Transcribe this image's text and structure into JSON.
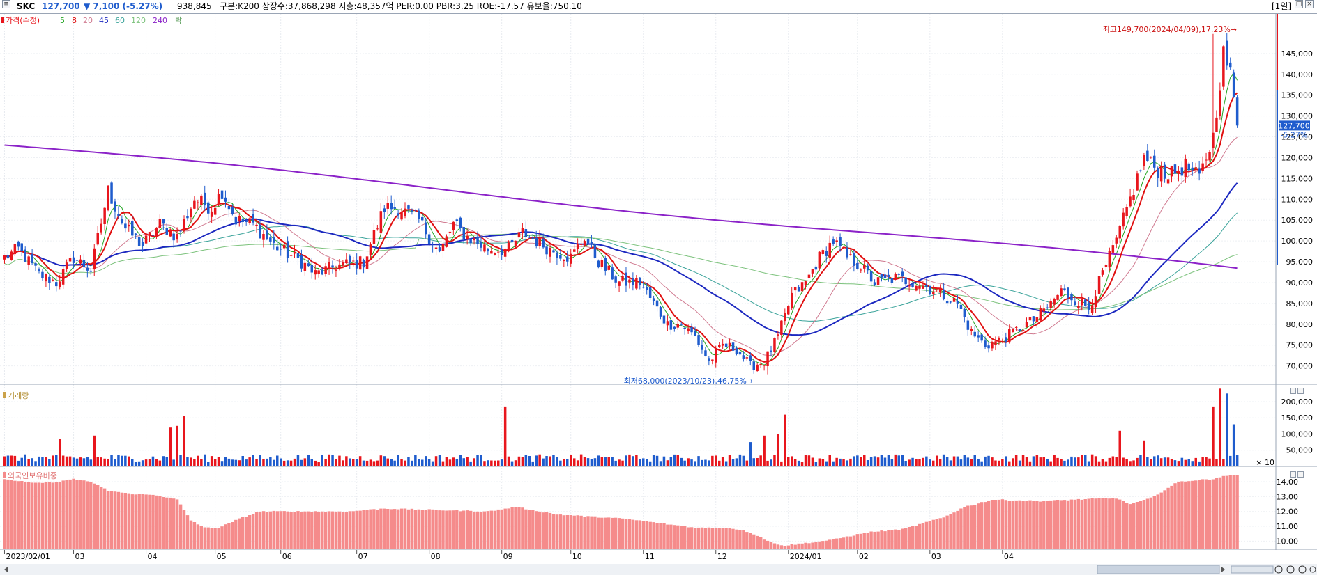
{
  "header": {
    "ticker": "SKC",
    "price": "127,700",
    "change_icon": "triangle-down-icon",
    "change": "▼ 7,100 (-5.27%)",
    "volume": "938,845",
    "info": "구분:K200 상장수:37,868,298 시총:48,357억 PER:0.00 PBR:3.25 ROE:-17.57 유보율:750.10",
    "period": "[1일]"
  },
  "legend": {
    "price": "가격(수정)",
    "ma5": "5",
    "ma8": "8",
    "ma20": "20",
    "ma45": "45",
    "ma60": "60",
    "ma120": "120",
    "ma240": "240",
    "rak": "락"
  },
  "volume_panel": {
    "title": "거래량",
    "multiplier": "× 10"
  },
  "foreign_panel": {
    "title": "외국인보유비중"
  },
  "annotations": {
    "high": "최고149,700(2024/04/09),17.23%→",
    "low": "최저68,000(2023/10/23),46.75%→",
    "current_price": "127,700",
    "current_change": "-5.27%"
  },
  "colors": {
    "up": "#e8161d",
    "down": "#1f5ccd",
    "ma5": "#22a522",
    "ma8": "#e01010",
    "ma20": "#d07a90",
    "ma45": "#1c28c0",
    "ma60": "#3aa39a",
    "ma120": "#7cc27c",
    "ma240": "#8b22c8",
    "foreign": "#f58b8b"
  },
  "chart_data": [
    {
      "type": "candlestick",
      "title": "SKC",
      "x_labels": [
        "2023/02/01",
        "03",
        "04",
        "05",
        "06",
        "07",
        "08",
        "09",
        "10",
        "11",
        "12",
        "2024/01",
        "02",
        "03",
        "04"
      ],
      "price_ticks": [
        145000,
        140000,
        135000,
        130000,
        125000,
        120000,
        115000,
        110000,
        105000,
        100000,
        95000,
        90000,
        85000,
        80000,
        75000,
        70000
      ],
      "price_tick_labels": [
        "145,000",
        "140,000",
        "135,000",
        "130,000",
        "125,000",
        "120,000",
        "115,000",
        "110,000",
        "105,000",
        "100,000",
        "95,000",
        "90,000",
        "85,000",
        "80,000",
        "75,000",
        "70,000"
      ],
      "ylim": [
        65600,
        154500
      ],
      "close_keypoints": [
        [
          0,
          96000
        ],
        [
          4,
          98000
        ],
        [
          10,
          92000
        ],
        [
          15,
          90000
        ],
        [
          20,
          96000
        ],
        [
          25,
          93000
        ],
        [
          30,
          112000
        ],
        [
          35,
          103000
        ],
        [
          40,
          99000
        ],
        [
          45,
          104000
        ],
        [
          50,
          101000
        ],
        [
          55,
          110000
        ],
        [
          60,
          108000
        ],
        [
          63,
          112000
        ],
        [
          67,
          105000
        ],
        [
          72,
          104000
        ],
        [
          78,
          99000
        ],
        [
          82,
          97000
        ],
        [
          86,
          95000
        ],
        [
          90,
          92000
        ],
        [
          96,
          94000
        ],
        [
          104,
          95000
        ],
        [
          110,
          108000
        ],
        [
          114,
          108000
        ],
        [
          120,
          105000
        ],
        [
          126,
          97000
        ],
        [
          130,
          104000
        ],
        [
          134,
          101000
        ],
        [
          140,
          98000
        ],
        [
          146,
          98000
        ],
        [
          150,
          102000
        ],
        [
          158,
          98000
        ],
        [
          164,
          96000
        ],
        [
          168,
          101000
        ],
        [
          172,
          95000
        ],
        [
          178,
          90000
        ],
        [
          184,
          90000
        ],
        [
          188,
          85000
        ],
        [
          192,
          80000
        ],
        [
          196,
          80000
        ],
        [
          200,
          77000
        ],
        [
          204,
          71000
        ],
        [
          208,
          75000
        ],
        [
          212,
          74000
        ],
        [
          216,
          70000
        ],
        [
          220,
          71000
        ],
        [
          224,
          77000
        ],
        [
          228,
          87000
        ],
        [
          232,
          90000
        ],
        [
          236,
          96000
        ],
        [
          240,
          100000
        ],
        [
          244,
          96000
        ],
        [
          248,
          94000
        ],
        [
          252,
          90000
        ],
        [
          258,
          91000
        ],
        [
          264,
          90000
        ],
        [
          270,
          88000
        ],
        [
          276,
          85000
        ],
        [
          280,
          78000
        ],
        [
          284,
          75000
        ],
        [
          288,
          76000
        ],
        [
          292,
          78000
        ],
        [
          298,
          81000
        ],
        [
          302,
          84000
        ],
        [
          306,
          88000
        ],
        [
          310,
          86000
        ],
        [
          314,
          84000
        ],
        [
          318,
          92000
        ],
        [
          322,
          100000
        ],
        [
          326,
          110000
        ],
        [
          330,
          120000
        ],
        [
          334,
          117000
        ],
        [
          338,
          116000
        ],
        [
          342,
          118000
        ],
        [
          346,
          115000
        ],
        [
          350,
          125000
        ],
        [
          353,
          145000
        ],
        [
          355,
          140000
        ],
        [
          357,
          127700
        ]
      ],
      "high": {
        "value": 149700,
        "date": "2024/04/09"
      },
      "low": {
        "value": 68000,
        "date": "2023/10/23"
      },
      "last_close": 127700,
      "moving_averages": [
        "5",
        "8",
        "20",
        "45",
        "60",
        "120",
        "240"
      ]
    },
    {
      "type": "bar",
      "title": "거래량",
      "unit_multiplier": 10,
      "y_ticks": [
        200000,
        150000,
        100000,
        50000
      ],
      "y_tick_labels": [
        "200,000",
        "150,000",
        "100,000",
        "50,000"
      ],
      "ylim": [
        0,
        245000
      ],
      "spikes": [
        {
          "day": 16,
          "value": 85000
        },
        {
          "day": 26,
          "value": 95000
        },
        {
          "day": 48,
          "value": 120000
        },
        {
          "day": 50,
          "value": 125000
        },
        {
          "day": 52,
          "value": 155000
        },
        {
          "day": 145,
          "value": 185000
        },
        {
          "day": 216,
          "value": 75000
        },
        {
          "day": 220,
          "value": 95000
        },
        {
          "day": 224,
          "value": 100000
        },
        {
          "day": 226,
          "value": 160000
        },
        {
          "day": 323,
          "value": 110000
        },
        {
          "day": 330,
          "value": 80000
        },
        {
          "day": 350,
          "value": 185000
        },
        {
          "day": 352,
          "value": 240000
        },
        {
          "day": 354,
          "value": 225000
        },
        {
          "day": 356,
          "value": 130000
        },
        {
          "day": 358,
          "value": 90000
        }
      ],
      "base_value": 25000
    },
    {
      "type": "bar",
      "title": "외국인보유비중",
      "y_ticks": [
        14,
        13,
        12,
        11,
        10
      ],
      "y_tick_labels": [
        "14.00",
        "13.00",
        "12.00",
        "11.00",
        "10.00"
      ],
      "ylim": [
        9.5,
        14.8
      ],
      "keypoints": [
        [
          0,
          14.2
        ],
        [
          8,
          13.9
        ],
        [
          16,
          14.0
        ],
        [
          20,
          14.2
        ],
        [
          26,
          13.9
        ],
        [
          30,
          13.4
        ],
        [
          36,
          13.2
        ],
        [
          44,
          13.1
        ],
        [
          50,
          12.8
        ],
        [
          54,
          11.4
        ],
        [
          58,
          10.9
        ],
        [
          62,
          10.9
        ],
        [
          68,
          11.5
        ],
        [
          74,
          12.0
        ],
        [
          100,
          12.0
        ],
        [
          110,
          12.2
        ],
        [
          140,
          12.0
        ],
        [
          148,
          12.3
        ],
        [
          160,
          11.8
        ],
        [
          180,
          11.5
        ],
        [
          200,
          10.9
        ],
        [
          210,
          10.9
        ],
        [
          216,
          10.6
        ],
        [
          222,
          9.9
        ],
        [
          226,
          9.7
        ],
        [
          240,
          10.1
        ],
        [
          250,
          10.6
        ],
        [
          260,
          10.8
        ],
        [
          272,
          11.6
        ],
        [
          278,
          12.3
        ],
        [
          286,
          12.8
        ],
        [
          300,
          12.7
        ],
        [
          310,
          12.8
        ],
        [
          322,
          12.9
        ],
        [
          326,
          12.5
        ],
        [
          332,
          12.9
        ],
        [
          340,
          14.0
        ],
        [
          350,
          14.2
        ],
        [
          356,
          14.5
        ],
        [
          359,
          14.3
        ]
      ]
    }
  ]
}
